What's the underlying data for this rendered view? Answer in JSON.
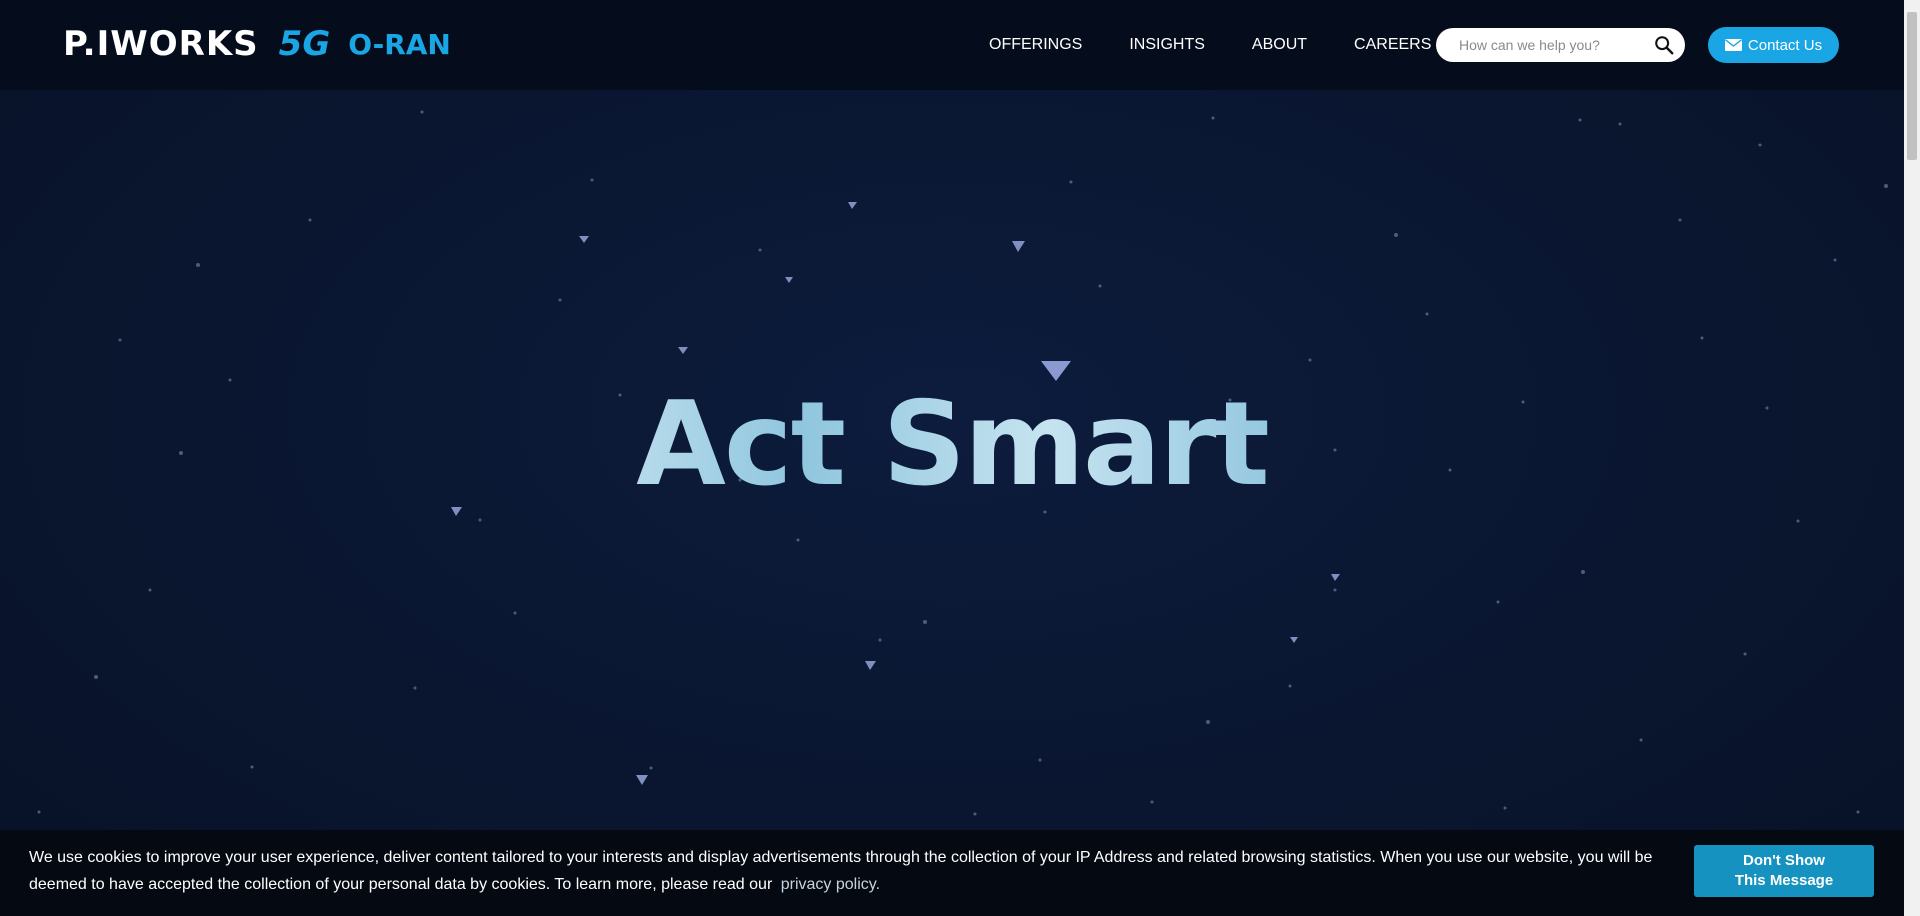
{
  "header": {
    "logo_text": "P.IWORKS",
    "logo_5g": "5G",
    "logo_oran": "O-RAN",
    "nav": [
      "OFFERINGS",
      "INSIGHTS",
      "ABOUT",
      "CAREERS"
    ],
    "search_placeholder": "How can we help you?",
    "contact_label": "Contact Us"
  },
  "hero": {
    "title": "Act Smart"
  },
  "cookie": {
    "message": "We use cookies to improve your user experience, deliver content tailored to your interests and display advertisements through the collection of your IP Address and related browsing statistics. When you use our website, you will be deemed to have accepted the collection of your personal data by cookies. To learn more, please read our",
    "link_label": "privacy policy.",
    "dismiss_line1": "Don't Show",
    "dismiss_line2": "This Message"
  },
  "colors": {
    "accent": "#1aa6e4",
    "background": "#0a1630",
    "header": "#050d1d",
    "dismiss_button": "#1592bf"
  }
}
